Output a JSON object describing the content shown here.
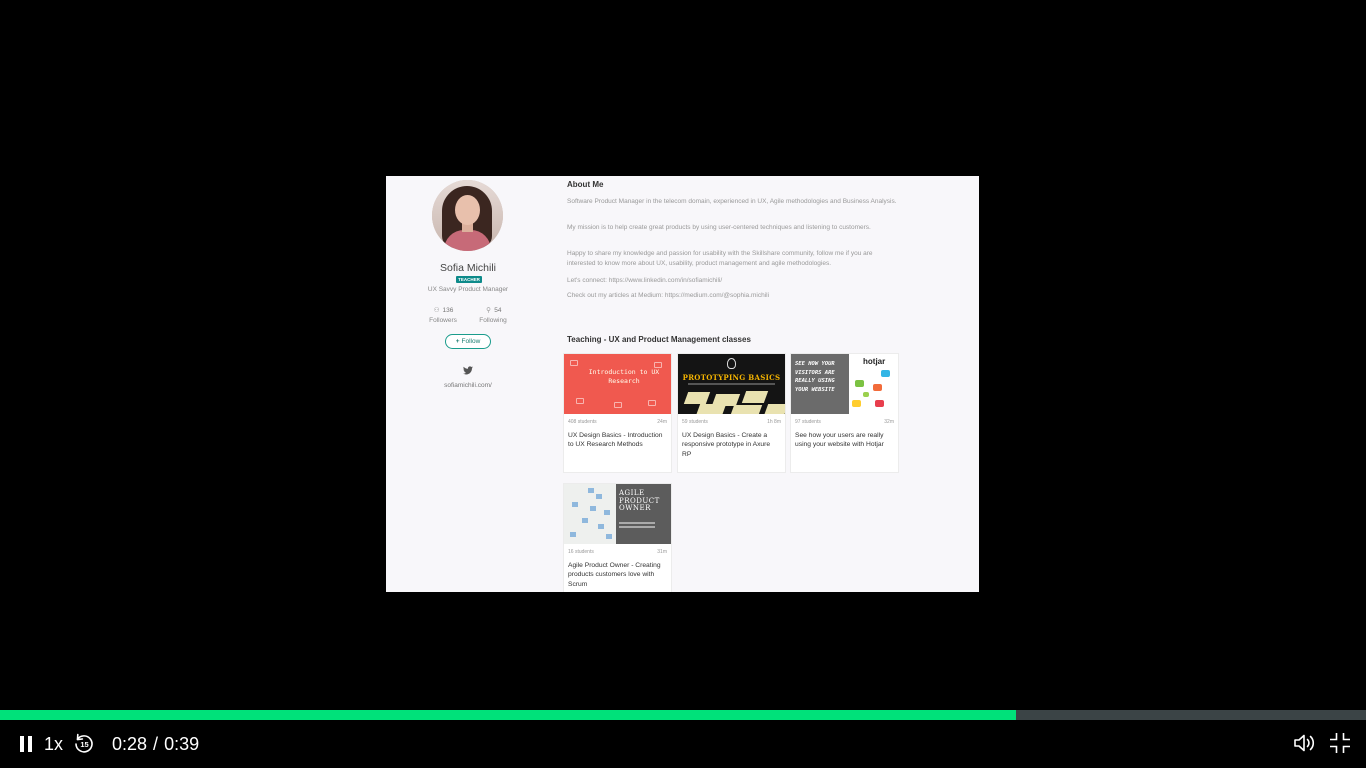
{
  "profile": {
    "name": "Sofia Michili",
    "badge": "TEACHER",
    "title": "UX Savvy Product Manager",
    "followers_count": "136",
    "followers_label": "Followers",
    "following_count": "54",
    "following_label": "Following",
    "follow_button": "Follow",
    "website": "sofiamichili.com/"
  },
  "about": {
    "heading": "About Me",
    "paragraphs": [
      "Software Product Manager in the telecom domain, experienced in UX, Agile methodologies and Business Analysis.",
      "My mission is to help create great products by using user-centered techniques and listening to customers.",
      "Happy to share my knowledge and passion for usability with the Skillshare community, follow me if you are interested to know more about UX, usability, product management and agile methodologies.",
      "Let's connect: https://www.linkedin.com/in/sofiamichili/",
      "Check out my articles at Medium: https://medium.com/@sophia.michili"
    ]
  },
  "teaching": {
    "heading": "Teaching - UX and Product Management classes",
    "classes": [
      {
        "thumb_text": "Introduction to UX Research",
        "students": "408 students",
        "duration": "24m",
        "title": "UX Design Basics - Introduction to UX Research Methods"
      },
      {
        "thumb_text": "PROTOTYPING BASICS",
        "students": "59 students",
        "duration": "1h 8m",
        "title": "UX Design Basics - Create a responsive prototype in Axure RP"
      },
      {
        "thumb_text": "SEE HOW YOUR VISITORS ARE REALLY USING YOUR WEBSITE",
        "thumb_logo": "hotjar",
        "students": "97 students",
        "duration": "32m",
        "title": "See how your users are really using your website with Hotjar"
      },
      {
        "thumb_text": "AGILE PRODUCT OWNER",
        "students": "16 students",
        "duration": "31m",
        "title": "Agile Product Owner - Creating products customers love with Scrum"
      }
    ]
  },
  "player": {
    "speed": "1x",
    "current_time": "0:28",
    "separator": "/",
    "duration": "0:39",
    "progress_fraction": 0.744,
    "accent_color": "#00e17a",
    "icons": [
      "pause-icon",
      "rewind-15-icon",
      "volume-icon",
      "exit-fullscreen-icon"
    ]
  }
}
